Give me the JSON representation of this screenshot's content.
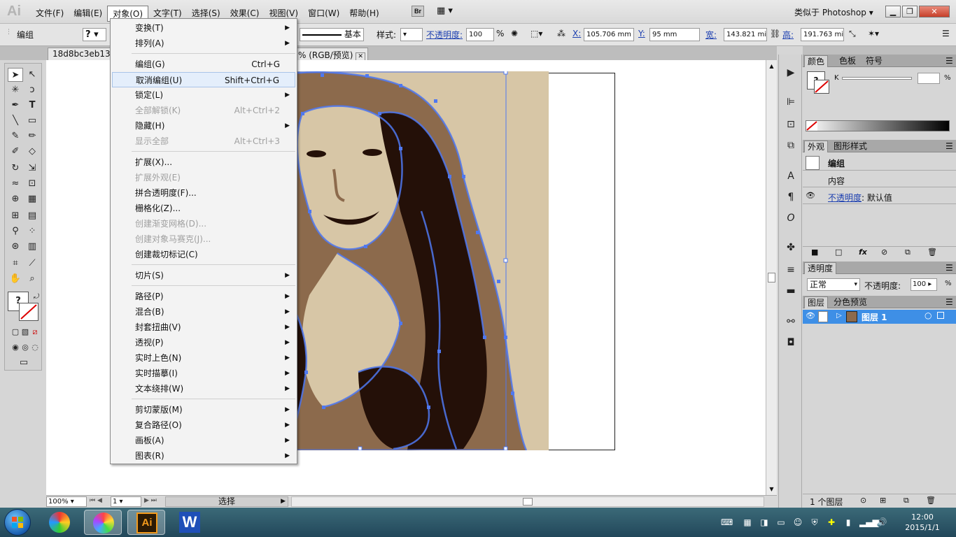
{
  "app": {
    "logo": "Ai",
    "workspace": "类似于 Photoshop",
    "bridge_label": "Br"
  },
  "menubar": {
    "items": [
      "文件(F)",
      "编辑(E)",
      "对象(O)",
      "文字(T)",
      "选择(S)",
      "效果(C)",
      "视图(V)",
      "窗口(W)",
      "帮助(H)"
    ],
    "active": "对象(O)"
  },
  "controlbar": {
    "selection_label": "编组",
    "stroke_profile": "基本",
    "style_label": "样式:",
    "opacity_label": "不透明度:",
    "opacity_value": "100",
    "percent": "%",
    "x_label": "X:",
    "x_value": "105.706 mm",
    "y_label": "Y:",
    "y_value": "95 mm",
    "w_label": "宽:",
    "w_value": "143.821 mi",
    "h_label": "高:",
    "h_value": "191.763 mi"
  },
  "document": {
    "tab_name": "18d8bc3eb135",
    "tab_suffix": "% (RGB/预览)"
  },
  "object_menu": {
    "items": [
      {
        "label": "变换(T)",
        "shortcut": "",
        "submenu": true,
        "disabled": false
      },
      {
        "label": "排列(A)",
        "shortcut": "",
        "submenu": true,
        "disabled": false
      },
      {
        "label": "编组(G)",
        "shortcut": "Ctrl+G",
        "submenu": false,
        "disabled": false
      },
      {
        "label": "取消编组(U)",
        "shortcut": "Shift+Ctrl+G",
        "submenu": false,
        "disabled": false,
        "highlighted": true
      },
      {
        "label": "锁定(L)",
        "shortcut": "",
        "submenu": true,
        "disabled": false
      },
      {
        "label": "全部解锁(K)",
        "shortcut": "Alt+Ctrl+2",
        "submenu": false,
        "disabled": true
      },
      {
        "label": "隐藏(H)",
        "shortcut": "",
        "submenu": true,
        "disabled": false
      },
      {
        "label": "显示全部",
        "shortcut": "Alt+Ctrl+3",
        "submenu": false,
        "disabled": true
      },
      {
        "label": "扩展(X)...",
        "shortcut": "",
        "submenu": false,
        "disabled": false
      },
      {
        "label": "扩展外观(E)",
        "shortcut": "",
        "submenu": false,
        "disabled": true
      },
      {
        "label": "拼合透明度(F)...",
        "shortcut": "",
        "submenu": false,
        "disabled": false
      },
      {
        "label": "栅格化(Z)...",
        "shortcut": "",
        "submenu": false,
        "disabled": false
      },
      {
        "label": "创建渐变网格(D)...",
        "shortcut": "",
        "submenu": false,
        "disabled": true
      },
      {
        "label": "创建对象马赛克(J)...",
        "shortcut": "",
        "submenu": false,
        "disabled": true
      },
      {
        "label": "创建裁切标记(C)",
        "shortcut": "",
        "submenu": false,
        "disabled": false
      },
      {
        "label": "切片(S)",
        "shortcut": "",
        "submenu": true,
        "disabled": false
      },
      {
        "label": "路径(P)",
        "shortcut": "",
        "submenu": true,
        "disabled": false
      },
      {
        "label": "混合(B)",
        "shortcut": "",
        "submenu": true,
        "disabled": false
      },
      {
        "label": "封套扭曲(V)",
        "shortcut": "",
        "submenu": true,
        "disabled": false
      },
      {
        "label": "透视(P)",
        "shortcut": "",
        "submenu": true,
        "disabled": false
      },
      {
        "label": "实时上色(N)",
        "shortcut": "",
        "submenu": true,
        "disabled": false
      },
      {
        "label": "实时描摹(I)",
        "shortcut": "",
        "submenu": true,
        "disabled": false
      },
      {
        "label": "文本绕排(W)",
        "shortcut": "",
        "submenu": true,
        "disabled": false
      },
      {
        "label": "剪切蒙版(M)",
        "shortcut": "",
        "submenu": true,
        "disabled": false
      },
      {
        "label": "复合路径(O)",
        "shortcut": "",
        "submenu": true,
        "disabled": false
      },
      {
        "label": "画板(A)",
        "shortcut": "",
        "submenu": true,
        "disabled": false
      },
      {
        "label": "图表(R)",
        "shortcut": "",
        "submenu": true,
        "disabled": false
      }
    ]
  },
  "statusbar": {
    "zoom": "100%",
    "artboard": "1",
    "tool": "选择"
  },
  "panels": {
    "color_tabs": [
      "颜色",
      "色板",
      "符号"
    ],
    "color_channel": "K",
    "appearance_tabs": [
      "外观",
      "图形样式"
    ],
    "appearance_title": "编组",
    "appearance_content": "内容",
    "appearance_opacity_label": "不透明度",
    "appearance_opacity_value": ": 默认值",
    "transparency_tab": "透明度",
    "blend_mode": "正常",
    "transparency_opacity_label": "不透明度:",
    "transparency_opacity_value": "100",
    "percent": "%",
    "layers_tabs": [
      "图层",
      "分色预览"
    ],
    "layer_name": "图层 1",
    "layer_count": "1 个图层"
  },
  "taskbar": {
    "time": "12:00",
    "date": "2015/1/1",
    "apps": [
      "windows-logo-app",
      "browser-app",
      "illustrator-app",
      "wps-writer-app"
    ],
    "ai_label": "Ai",
    "wps_label": "W"
  },
  "colors": {
    "selection_blue": "#4f78f0",
    "dark_hair": "#241008",
    "mid_tone": "#8c6a4c",
    "light_tone": "#d7c6a6",
    "layer_highlight": "#3e8fe6"
  }
}
